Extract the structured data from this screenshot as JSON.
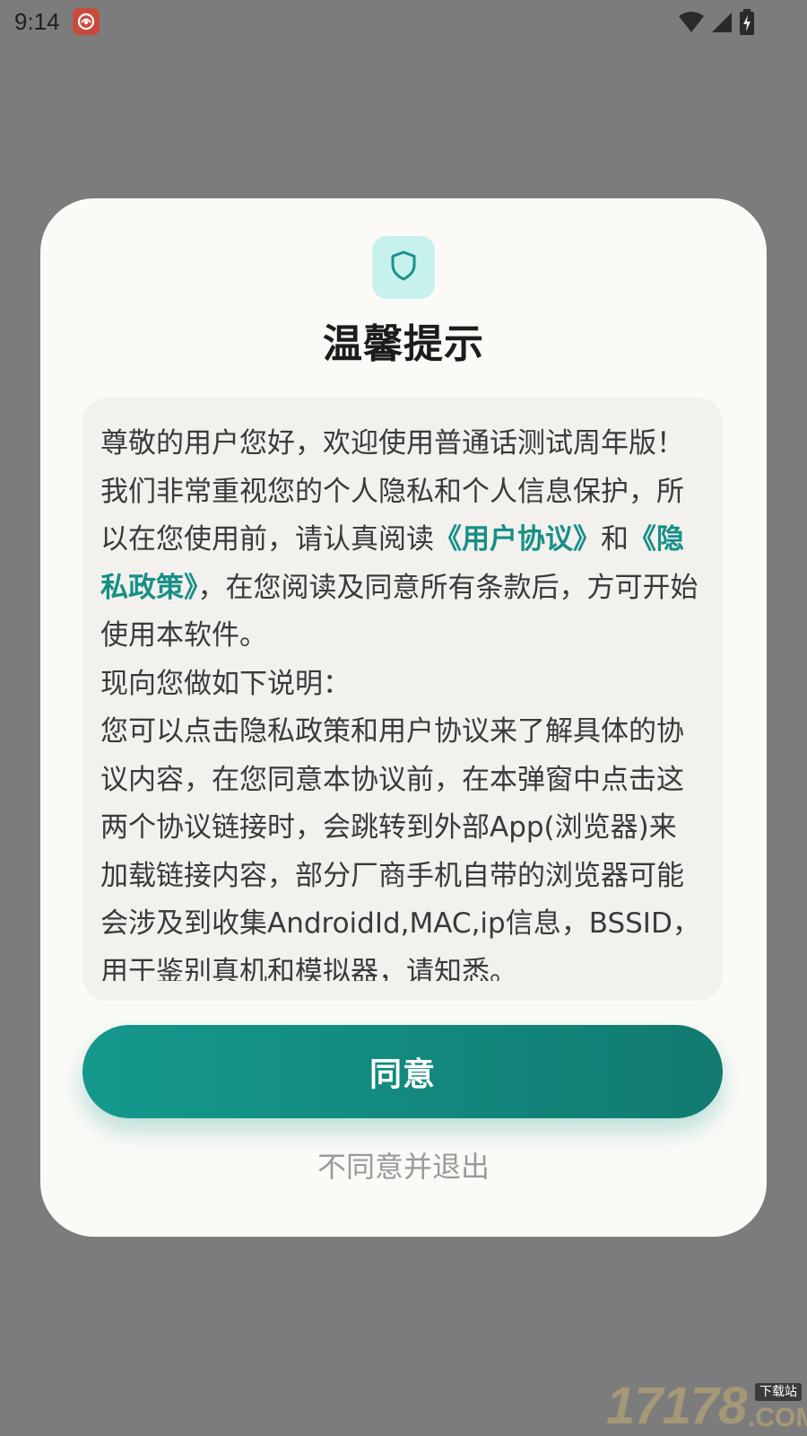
{
  "status_bar": {
    "time": "9:14",
    "icons": [
      "app-notification-icon",
      "wifi-icon",
      "cellular-signal-icon",
      "battery-charging-icon"
    ]
  },
  "dialog": {
    "icon": "shield-icon",
    "title": "温馨提示",
    "content": {
      "intro_before_links": "尊敬的用户您好，欢迎使用普通话测试周年版！我们非常重视您的个人隐私和个人信息保护，所以在您使用前，请认真阅读",
      "user_agreement_link": "《用户协议》",
      "conjunction": "和",
      "privacy_policy_link": "《隐私政策》",
      "intro_after_links": "，在您阅读及同意所有条款后，方可开始使用本软件。",
      "explanation_heading": "现向您做如下说明：",
      "explanation_body": "您可以点击隐私政策和用户协议来了解具体的协议内容，在您同意本协议前，在本弹窗中点击这两个协议链接时，会跳转到外部App(浏览器)来加载链接内容，部分厂商手机自带的浏览器可能会涉及到收集AndroidId,MAC,ip信息，BSSID，用于鉴别真机和模拟器，请知悉。"
    },
    "agree_label": "同意",
    "decline_label": "不同意并退出"
  },
  "watermark": {
    "number": "17178",
    "tag": "下载站",
    "suffix": ".COM"
  },
  "colors": {
    "accent": "#178f86",
    "button_gradient_start": "#14998c",
    "button_gradient_end": "#127a70",
    "shield_badge_bg": "#c7f1ec",
    "overlay": "#7c7c7c",
    "dialog_bg": "#fbfaf7"
  }
}
